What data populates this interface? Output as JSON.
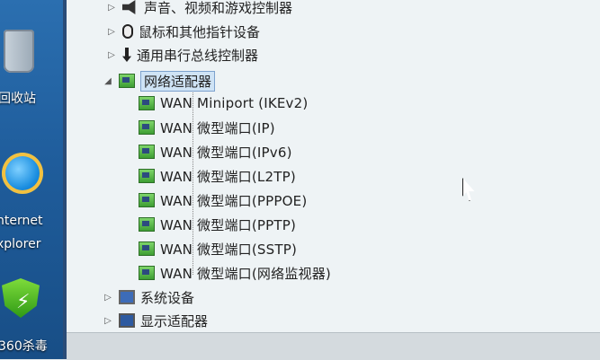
{
  "desktop": {
    "icons": [
      {
        "name": "recycle-bin",
        "label": "回收站"
      },
      {
        "name": "internet-explorer",
        "label1": "nternet",
        "label2": "xplorer"
      },
      {
        "name": "360-guard",
        "label": "360杀毒"
      }
    ]
  },
  "tree": {
    "top_items": [
      {
        "label": "声音、视频和游戏控制器",
        "icon": "speaker-icon"
      },
      {
        "label": "鼠标和其他指针设备",
        "icon": "mouse-icon"
      },
      {
        "label": "通用串行总线控制器",
        "icon": "usb-icon"
      }
    ],
    "network": {
      "label": "网络适配器",
      "icon": "network-adapter-icon",
      "children": [
        "WAN Miniport (IKEv2)",
        "WAN 微型端口(IP)",
        "WAN 微型端口(IPv6)",
        "WAN 微型端口(L2TP)",
        "WAN 微型端口(PPPOE)",
        "WAN 微型端口(PPTP)",
        "WAN 微型端口(SSTP)",
        "WAN 微型端口(网络监视器)"
      ]
    },
    "bottom_items": [
      {
        "label": "系统设备",
        "icon": "computer-icon"
      },
      {
        "label": "显示适配器",
        "icon": "monitor-icon"
      }
    ]
  }
}
